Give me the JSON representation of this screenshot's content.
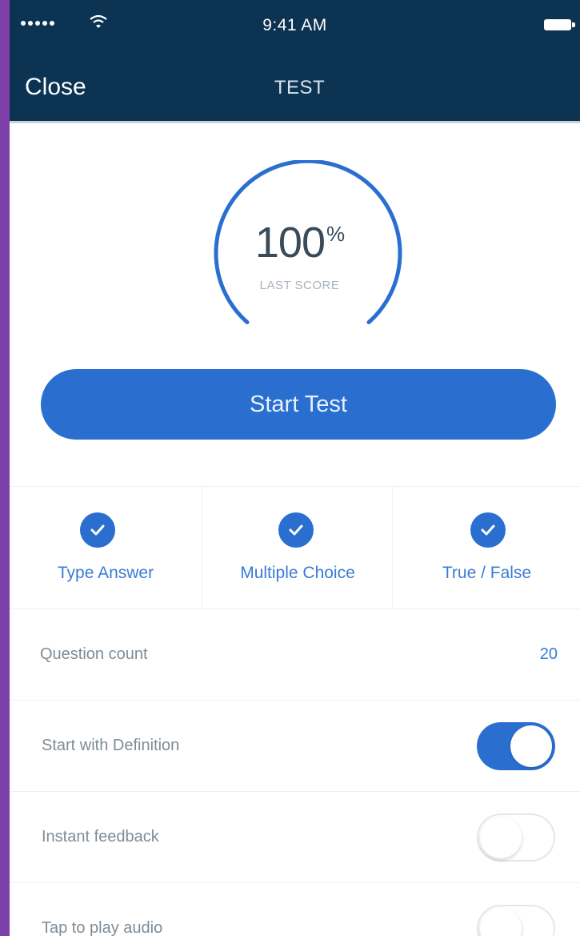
{
  "status_bar": {
    "time": "9:41 AM",
    "signal_icon": "signal-dots-icon",
    "wifi_icon": "wifi-icon",
    "battery_icon": "battery-icon"
  },
  "nav": {
    "close_label": "Close",
    "title": "TEST"
  },
  "score": {
    "value": "100",
    "unit": "%",
    "label": "LAST SCORE",
    "progress": 1.0
  },
  "start_button": {
    "label": "Start Test"
  },
  "question_types": [
    {
      "label": "Type Answer",
      "checked": true,
      "icon": "checkmark-icon"
    },
    {
      "label": "Multiple Choice",
      "checked": true,
      "icon": "checkmark-icon"
    },
    {
      "label": "True / False",
      "checked": true,
      "icon": "checkmark-icon"
    }
  ],
  "settings": {
    "question_count": {
      "label": "Question count",
      "value": "20"
    },
    "start_with_definition": {
      "label": "Start with Definition",
      "on": true
    },
    "instant_feedback": {
      "label": "Instant feedback",
      "on": false
    },
    "tap_to_play_audio": {
      "label": "Tap to play audio",
      "on": false
    }
  },
  "colors": {
    "nav_background": "#0c3352",
    "accent": "#2a6fd0",
    "frame": "#7d3fa8"
  }
}
